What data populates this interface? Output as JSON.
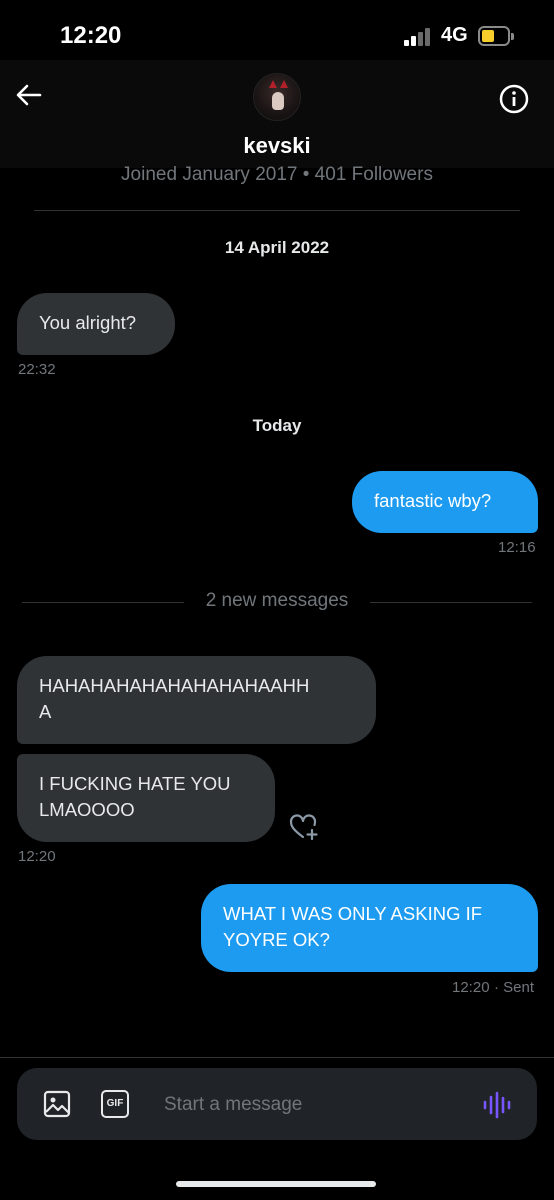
{
  "status_bar": {
    "time": "12:20",
    "network": "4G"
  },
  "header": {
    "username": "kevski",
    "joined": "Joined January 2017 • 401 Followers"
  },
  "conversation": {
    "date_separator_1": "14 April 2022",
    "msg1": {
      "text": "You alright?",
      "time": "22:32"
    },
    "date_separator_2": "Today",
    "msg2": {
      "text": "fantastic wby?",
      "time": "12:16"
    },
    "new_messages_label": "2 new messages",
    "msg3": {
      "line1": "HAHAHAHAHAHAHAHAHAAHH",
      "line2": "A"
    },
    "msg4": {
      "line1": "I FUCKING HATE YOU",
      "line2": "LMAOOOO",
      "time": "12:20"
    },
    "msg5": {
      "line1": "WHAT I WAS ONLY ASKING IF",
      "line2": "YOYRE OK?",
      "time": "12:20",
      "status": "· Sent"
    }
  },
  "composer": {
    "placeholder": "Start a message",
    "gif_label": "GIF"
  },
  "colors": {
    "background": "#000000",
    "incoming_bubble": "#2f3336",
    "outgoing_bubble": "#1d9bf0",
    "voice_accent": "#7856ff",
    "battery": "#f7ce2c"
  }
}
